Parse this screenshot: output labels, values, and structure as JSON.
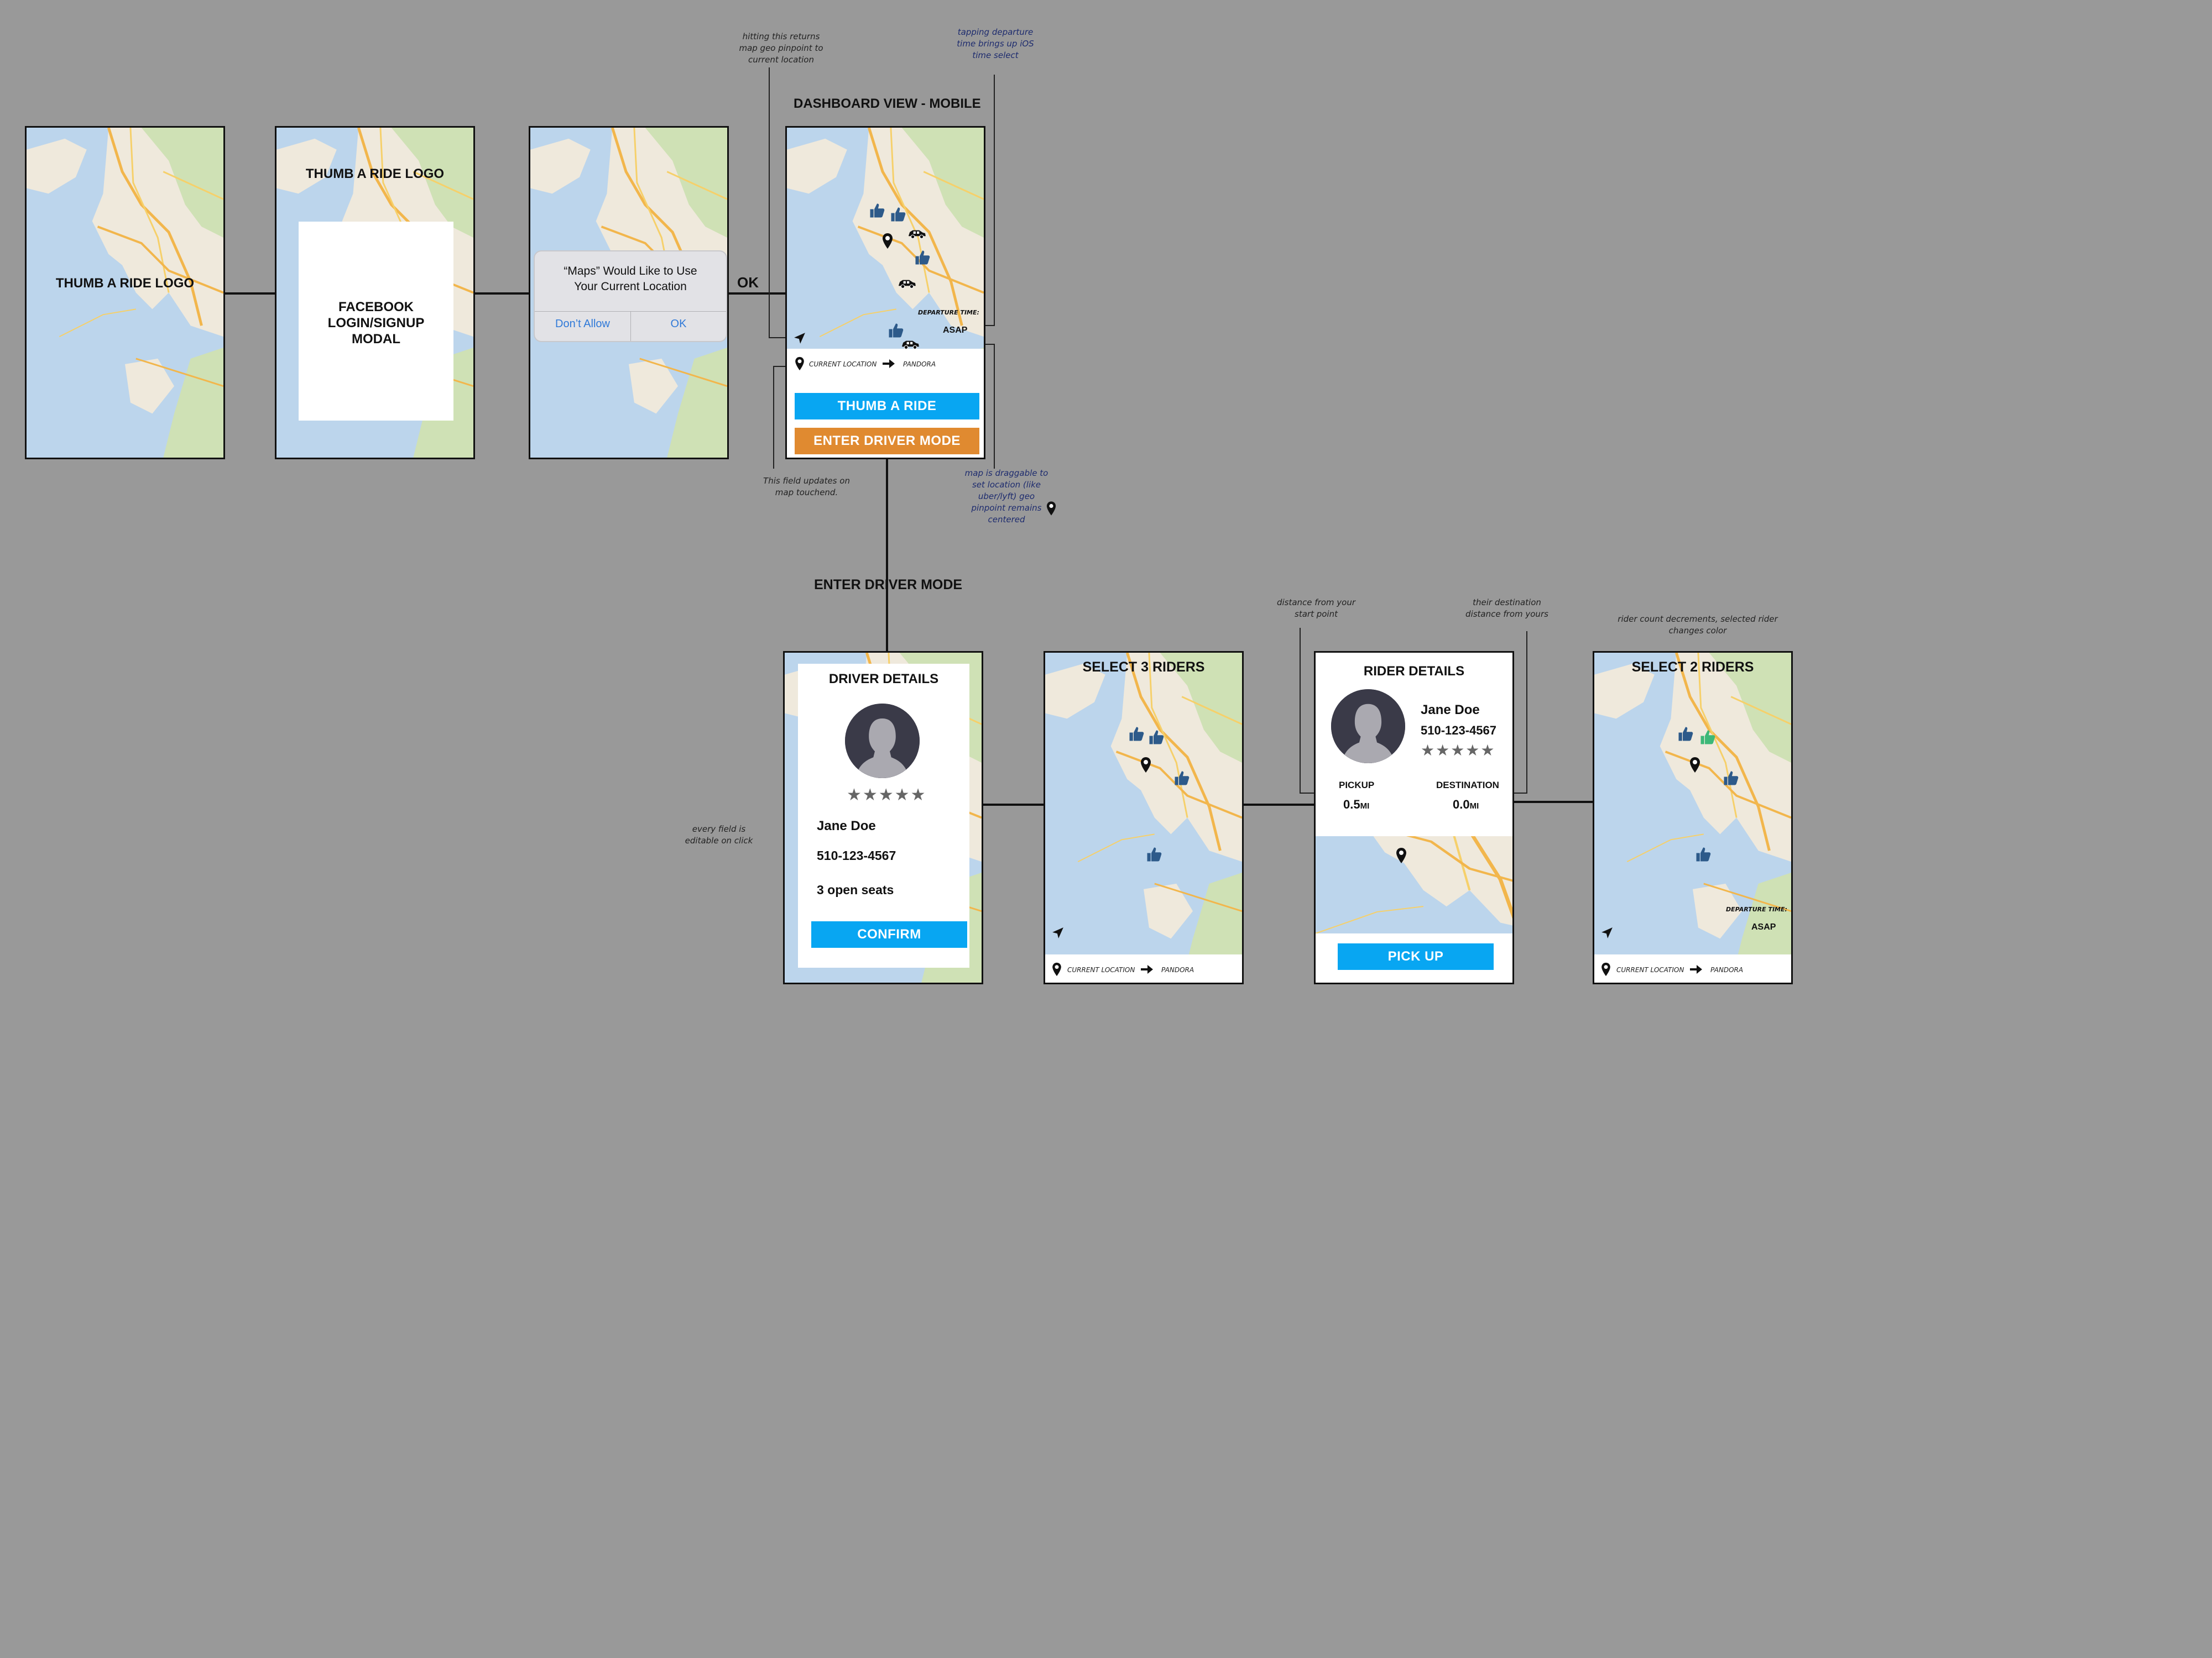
{
  "colors": {
    "background": "#999999",
    "accent_blue": "#08a6f2",
    "accent_orange": "#e08a30",
    "thumb_blue": "#2d5a8a",
    "thumb_green": "#3cb878"
  },
  "icons": [
    "thumbs-up-icon",
    "car-icon",
    "map-pin-icon",
    "location-arrow-icon",
    "arrow-right-icon",
    "avatar-icon",
    "star-icon"
  ],
  "screens": {
    "s1": {
      "logo": "THUMB A RIDE LOGO"
    },
    "s2": {
      "logo": "THUMB A RIDE LOGO",
      "modal_text": "FACEBOOK LOGIN/SIGNUP MODAL"
    },
    "s3": {
      "alert_title": "“Maps” Would Like to Use Your Current Location",
      "dont_allow": "Don’t Allow",
      "ok": "OK"
    },
    "dashboard": {
      "title": "DASHBOARD VIEW - MOBILE",
      "departure_label": "DEPARTURE TIME:",
      "departure_value": "ASAP",
      "from": "CURRENT LOCATION",
      "to": "PANDORA",
      "thumb_button": "THUMB A RIDE",
      "driver_button": "ENTER DRIVER MODE"
    },
    "driver": {
      "title": "DRIVER DETAILS",
      "stars": "★★★★★",
      "name": "Jane Doe",
      "phone": "510-123-4567",
      "seats": "3 open seats",
      "confirm": "CONFIRM"
    },
    "select3": {
      "title": "SELECT 3 RIDERS",
      "from": "CURRENT LOCATION",
      "to": "PANDORA"
    },
    "rider": {
      "title": "RIDER DETAILS",
      "name": "Jane Doe",
      "phone": "510-123-4567",
      "stars": "★★★★★",
      "pickup_label": "PICKUP",
      "pickup_value": "0.5",
      "pickup_unit": "MI",
      "destination_label": "DESTINATION",
      "destination_value": "0.0",
      "destination_unit": "MI",
      "pickup_button": "PICK UP"
    },
    "select2": {
      "title": "SELECT 2 RIDERS",
      "departure_label": "DEPARTURE TIME:",
      "departure_value": "ASAP",
      "from": "CURRENT LOCATION",
      "to": "PANDORA"
    }
  },
  "flow_labels": {
    "ok": "OK",
    "enter_driver_mode": "ENTER DRIVER MODE"
  },
  "annotations": {
    "recenter": "hitting this returns map geo pinpoint to current location",
    "departure": "tapping departure time brings up iOS time select",
    "field_updates": "This field updates on map touchend.",
    "draggable": "map is draggable to set location (like uber/lyft) geo pinpoint remains centered",
    "editable": "every field is editable on click",
    "distance_start": "distance from your start point",
    "distance_dest": "their destination distance from yours",
    "rider_count": "rider count decrements, selected rider changes color"
  }
}
